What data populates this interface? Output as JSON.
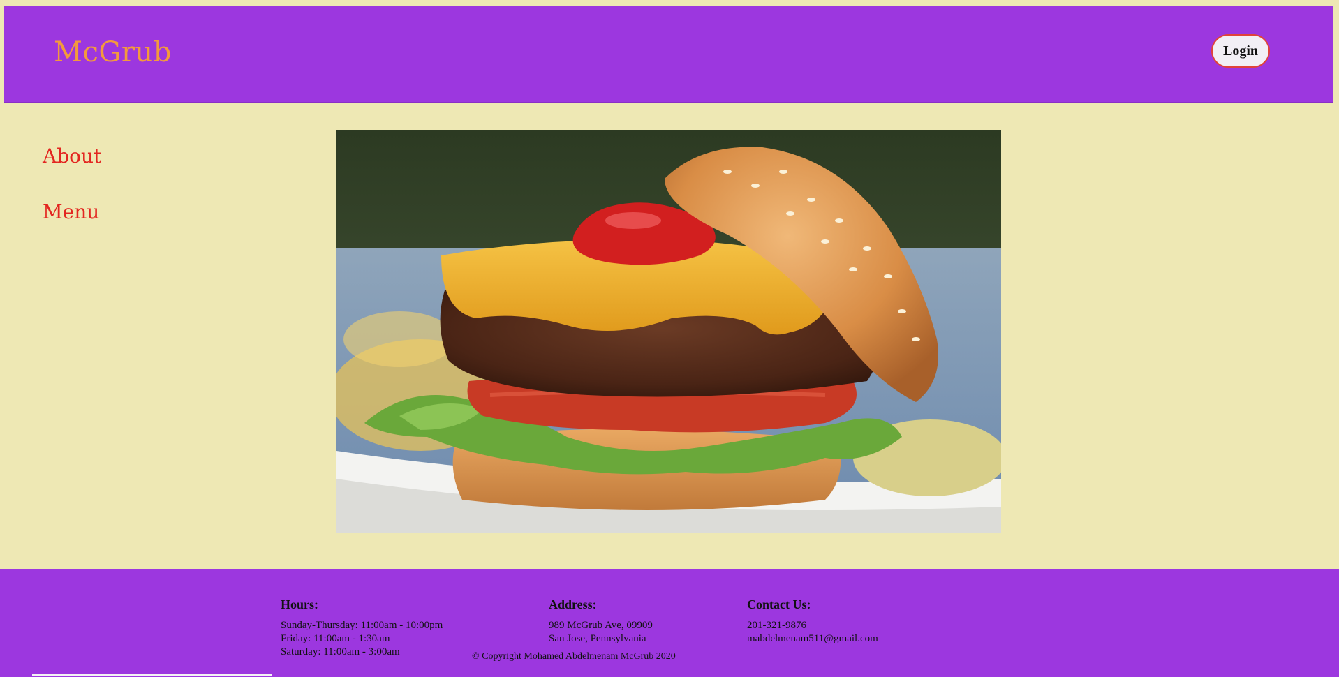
{
  "header": {
    "brand": "McGrub",
    "login_label": "Login"
  },
  "nav": {
    "items": [
      {
        "label": "About"
      },
      {
        "label": "Menu"
      }
    ]
  },
  "hero": {
    "image_name": "cheeseburger-photo"
  },
  "footer": {
    "hours": {
      "title": "Hours:",
      "lines": [
        "Sunday-Thursday: 11:00am - 10:00pm",
        "Friday: 11:00am - 1:30am",
        "Saturday: 11:00am - 3:00am"
      ]
    },
    "address": {
      "title": "Address:",
      "lines": [
        "989 McGrub Ave, 09909",
        "San Jose, Pennsylvania"
      ]
    },
    "contact": {
      "title": "Contact Us:",
      "lines": [
        "201-321-9876",
        "mabdelmenam511@gmail.com"
      ]
    },
    "copyright": "© Copyright Mohamed Abdelmenam McGrub 2020"
  },
  "colors": {
    "background": "#eee8b4",
    "header_footer": "#9c37df",
    "brand": "#f39a3c",
    "nav_link": "#e32620",
    "login_border": "#e0433a"
  }
}
